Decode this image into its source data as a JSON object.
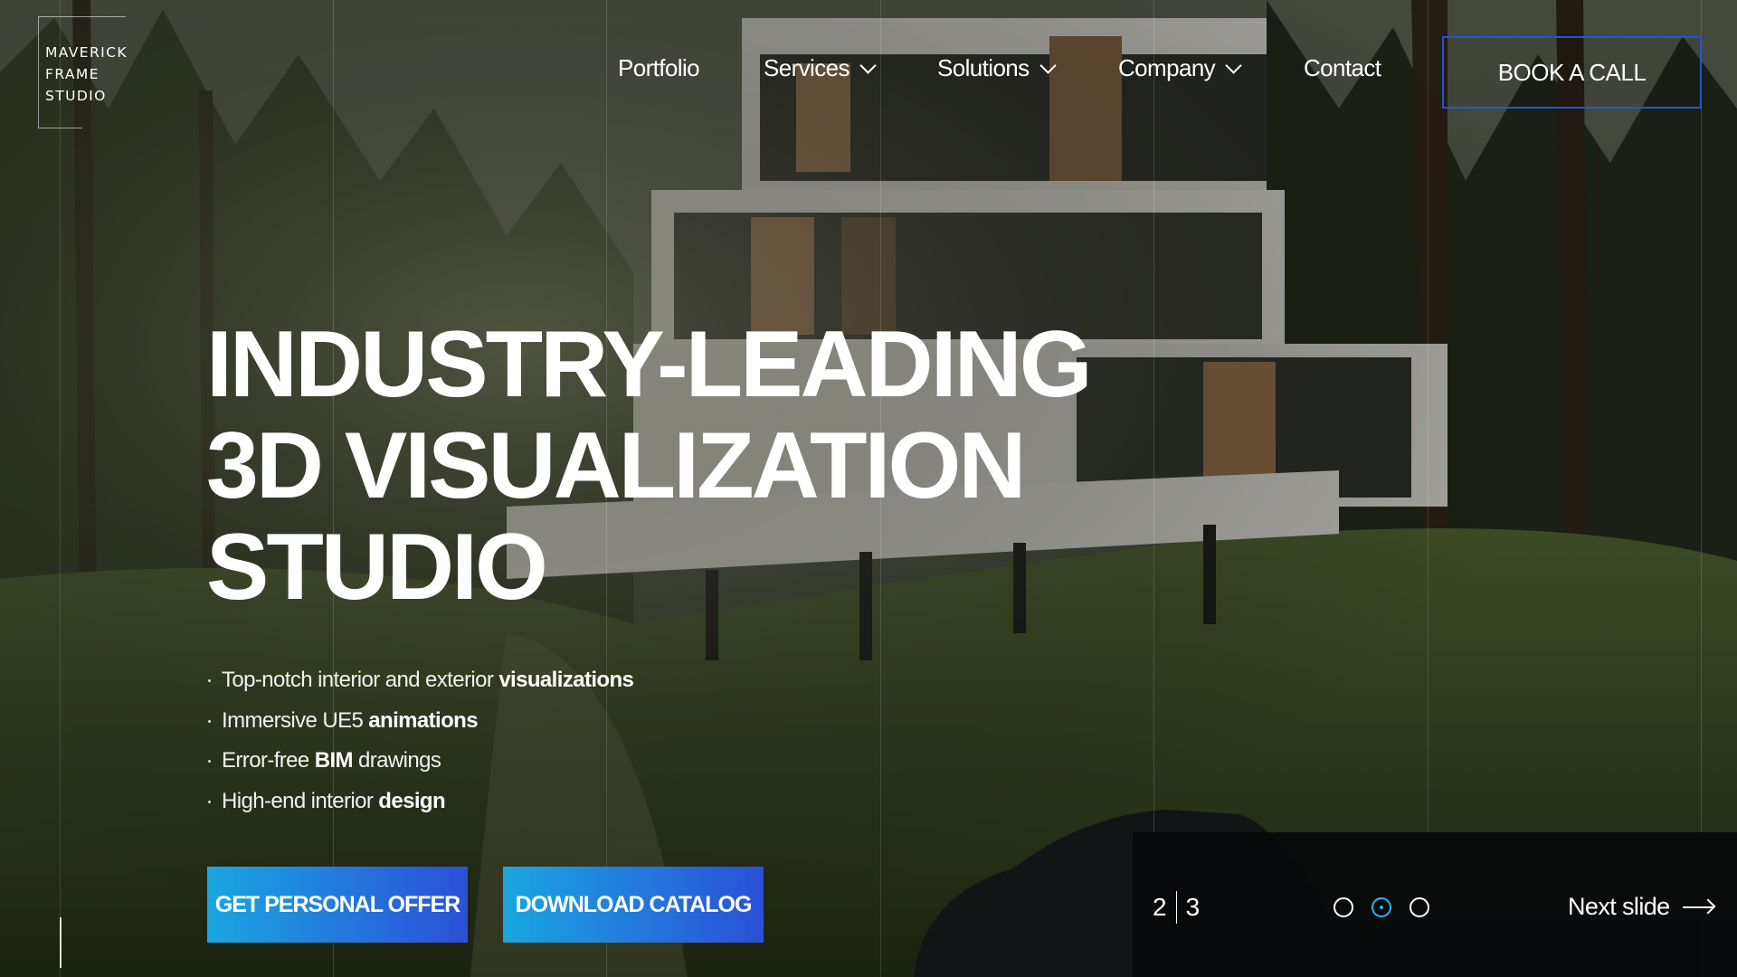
{
  "logo": {
    "lines": [
      "MAVERICK",
      "FRAME",
      "STUDIO"
    ]
  },
  "nav": {
    "items": [
      {
        "label": "Portfolio",
        "has_dropdown": false
      },
      {
        "label": "Services",
        "has_dropdown": true
      },
      {
        "label": "Solutions",
        "has_dropdown": true
      },
      {
        "label": "Company",
        "has_dropdown": true
      },
      {
        "label": "Contact",
        "has_dropdown": false
      }
    ],
    "cta_label": "BOOK A CALL"
  },
  "hero": {
    "headline": [
      "INDUSTRY-LEADING",
      "3D VISUALIZATION",
      "STUDIO"
    ],
    "features": [
      {
        "text": "Top-notch interior and exterior",
        "bold": "visualizations"
      },
      {
        "text": "Immersive UE5",
        "bold": "animations"
      },
      {
        "text": "Error-free",
        "bold": "BIM",
        "after": "drawings"
      },
      {
        "text": "High-end interior",
        "bold": "design"
      }
    ],
    "primary_cta": "GET PERSONAL OFFER",
    "secondary_cta": "DOWNLOAD CATALOG"
  },
  "slider": {
    "current": "2",
    "total": "3",
    "active_dot": 2,
    "next_label": "Next slide"
  },
  "colors": {
    "accent_blue": "#2b4fd8",
    "accent_cyan": "#1aa6e0",
    "active_dot": "#2bb3f0"
  },
  "icons": [
    "chevron-down-icon",
    "arrow-right-icon",
    "slider-dot-icon"
  ]
}
